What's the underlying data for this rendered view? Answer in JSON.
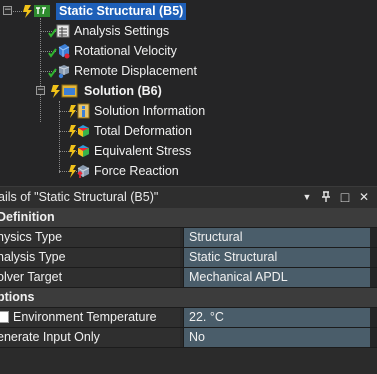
{
  "tree": {
    "root": {
      "label": "Static Structural (B5)",
      "icon": "static-structural-icon",
      "expander": "−"
    },
    "children": [
      {
        "label": "Analysis Settings",
        "icon": "analysis-settings-icon"
      },
      {
        "label": "Rotational Velocity",
        "icon": "rotational-velocity-icon"
      },
      {
        "label": "Remote Displacement",
        "icon": "remote-displacement-icon"
      }
    ],
    "solution": {
      "label": "Solution (B6)",
      "icon": "solution-icon",
      "expander": "−",
      "children": [
        {
          "label": "Solution Information",
          "icon": "solution-information-icon"
        },
        {
          "label": "Total Deformation",
          "icon": "total-deformation-icon"
        },
        {
          "label": "Equivalent Stress",
          "icon": "equivalent-stress-icon"
        },
        {
          "label": "Force Reaction",
          "icon": "force-reaction-icon"
        }
      ]
    }
  },
  "details": {
    "title": "ails of \"Static Structural (B5)\"",
    "buttons": {
      "dropdown": "▼",
      "pin": "ᚱ",
      "maximize": "□",
      "close": "✕"
    },
    "sections": [
      {
        "name": "Definition",
        "rows": [
          {
            "key": "hysics Type",
            "value": "Structural"
          },
          {
            "key": "nalysis Type",
            "value": "Static Structural"
          },
          {
            "key": "olver Target",
            "value": "Mechanical APDL"
          }
        ]
      },
      {
        "name": "ptions",
        "rows": [
          {
            "key": "Environment Temperature",
            "value": "22. °C",
            "checkbox": true
          },
          {
            "key": "enerate Input Only",
            "value": "No"
          }
        ]
      }
    ]
  },
  "colors": {
    "selection": "#1e5fb8",
    "value_cell": "#4a5d6a",
    "check_green": "#2fb52f",
    "bolt_yellow": "#f0c21a"
  }
}
